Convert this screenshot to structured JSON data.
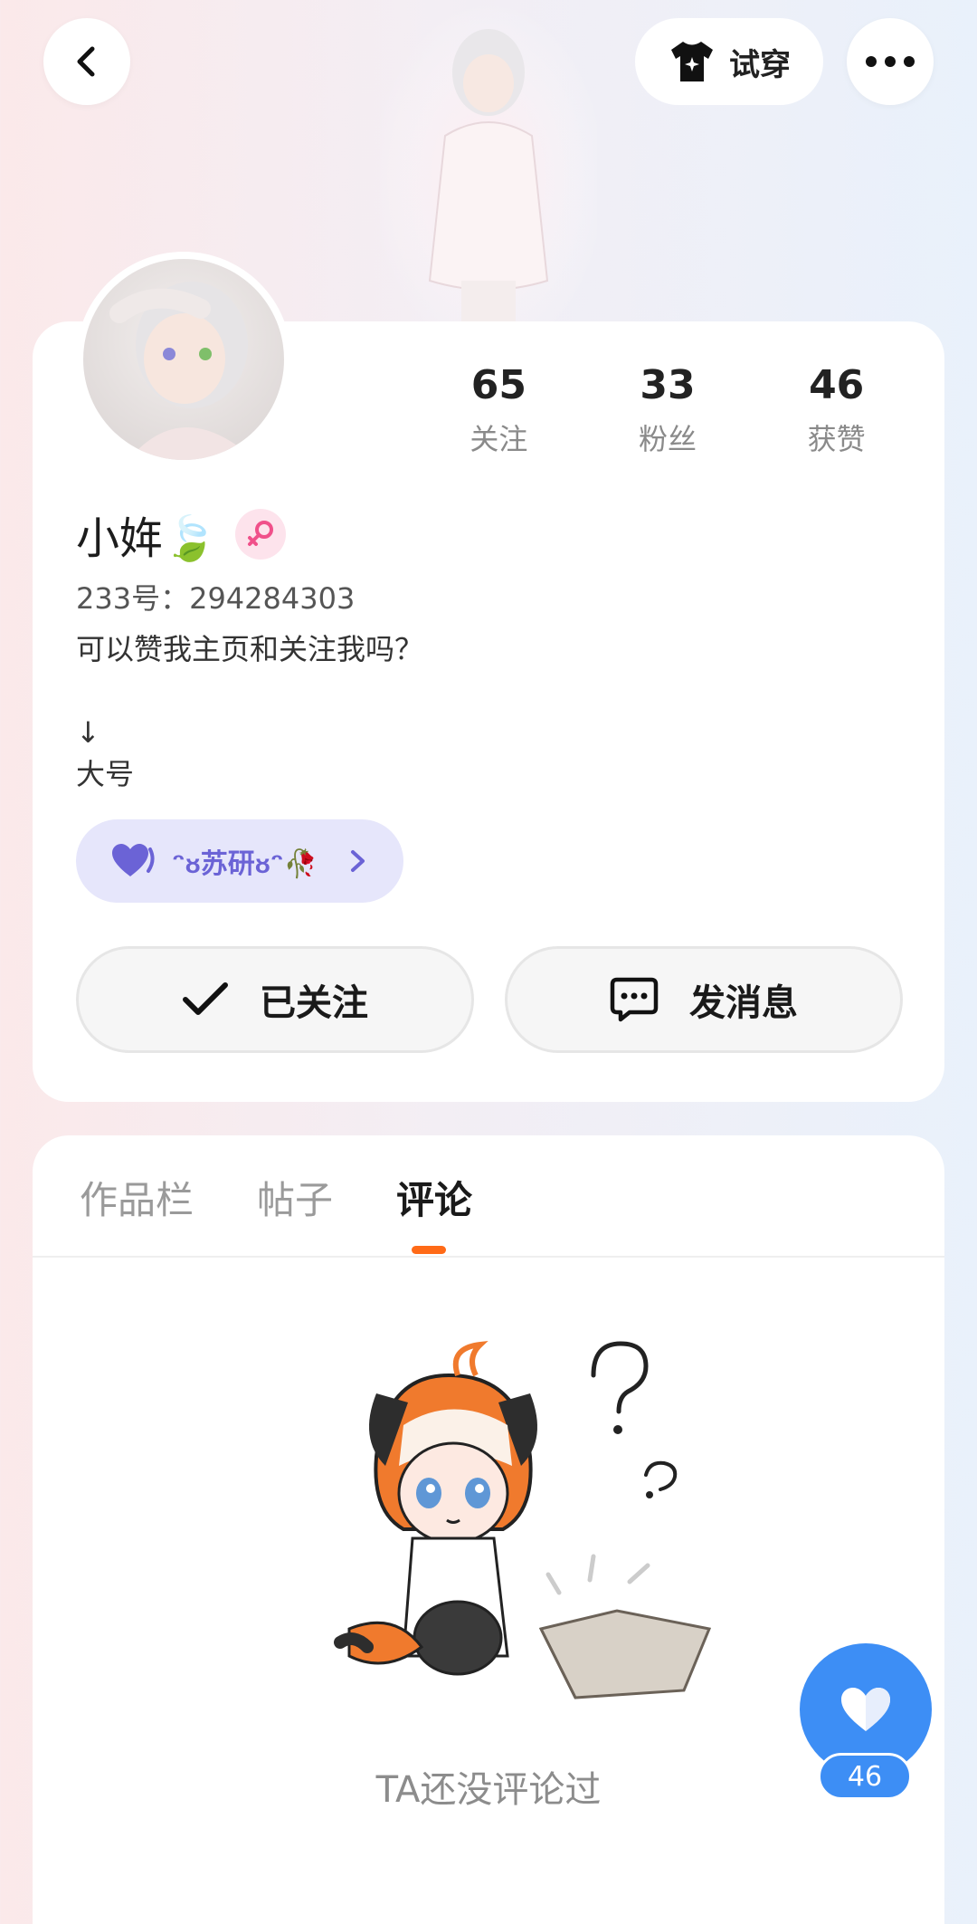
{
  "header": {
    "tryon_label": "试穿"
  },
  "stats": [
    {
      "value": "65",
      "label": "关注"
    },
    {
      "value": "33",
      "label": "粉丝"
    },
    {
      "value": "46",
      "label": "获赞"
    }
  ],
  "profile": {
    "name": "小姩🍃",
    "uid": "233号：294284303",
    "bio": "可以赞我主页和关注我吗？\n\n↓\n大号",
    "group_label": "ᵔᴕ苏研ᴕᵔ🥀"
  },
  "actions": {
    "follow_label": "已关注",
    "message_label": "发消息"
  },
  "tabs": [
    {
      "label": "作品栏",
      "active": false
    },
    {
      "label": "帖子",
      "active": false
    },
    {
      "label": "评论",
      "active": true
    }
  ],
  "empty_state": {
    "text": "TA还没评论过"
  },
  "like": {
    "count": "46"
  },
  "colors": {
    "accent": "#ff6a17",
    "like_blue": "#3d8ef5",
    "group_purple": "#6b63d6"
  }
}
